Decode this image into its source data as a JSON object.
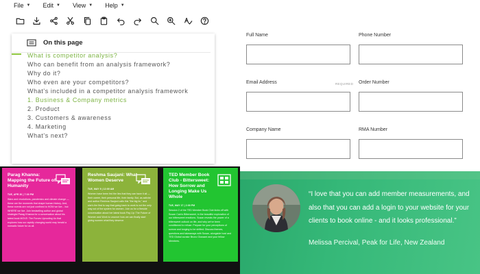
{
  "menubar": {
    "items": [
      {
        "label": "File"
      },
      {
        "label": "Edit"
      },
      {
        "label": "View"
      },
      {
        "label": "Help"
      }
    ]
  },
  "toolbar": {
    "icons": [
      "folder-open-icon",
      "download-icon",
      "share-icon",
      "cut-icon",
      "copy-icon",
      "paste-icon",
      "undo-icon",
      "redo-icon",
      "zoom-in-icon",
      "zoom-out-icon",
      "spell-check-icon",
      "help-icon"
    ]
  },
  "toc": {
    "title": "On this page",
    "items": [
      {
        "label": "What is competitor analysis?"
      },
      {
        "label": "Who can benefit from an analysis framework?"
      },
      {
        "label": "Why do it?"
      },
      {
        "label": "Who even are your competitors?"
      },
      {
        "label": "What's included in a competitor analysis framework"
      },
      {
        "label": "1. Business & Company metrics"
      },
      {
        "label": "2. Product"
      },
      {
        "label": "3. Customers & awareness"
      },
      {
        "label": "4. Marketing"
      },
      {
        "label": "What's next?"
      }
    ]
  },
  "form": {
    "full_name": "Full Name",
    "phone_number": "Phone Number",
    "email_address": "Email Address",
    "required": "REQUIRED",
    "order_number": "Order Number",
    "company_name": "Company Name",
    "rma_number": "RMA Number"
  },
  "cards": [
    {
      "title": "Parag Khanna: Mapping the Future of Humanity",
      "meta": "TUE, APR 20 | 7:00 PM",
      "body": "Wars and revolutions, pandemics and climate change — these are the moments that shape human history. And, these events are not just confined to HOW we live... but WHERE we live. Join bestselling author and global strategist Parag Khanna for a conversation about his latest book MOVE: The Forces Uprooting Us that explores how our rapidly changing world may herald a nomadic future for us all.",
      "color": "#e6289b"
    },
    {
      "title": "Reshma Saujani: What Women Deserve",
      "meta": "TUE, MAY 9 | 12:00 AM",
      "body": "Women have been fed the lies that they can have it all — their career, their personal life, their family. But, as activist and author Reshma Saujani calls this \"the big lie,\" and she's the first to say that going back to work is not the only way out of the system for women. Join us for a fireside conversation about her latest book Pay Up: The Future of Women and Work to uncover how we can finally start giving women what they deserve.",
      "color": "#8cb33b"
    },
    {
      "title": "TED Member Book Club - Bittersweet: How Sorrow and Longing Make Us Whole",
      "meta": "TUE, MAY 17 | 2:00 PM",
      "body": "Session 2 of the TED Member Book Club kicks off with Susan Cain's Bittersweet, in the beautiful exploration of our bittersweet emotions. Susan reveals the power of a bittersweet outlook on life, and why we've been conditioned to refuse. Prepare for your perceptions of sorrow and longing to be shifted. Discuss themes, questions and takeaways with Susan, alongside host and TED Global curator Bruno Giussani and your fellow Members.",
      "color": "#22c531"
    }
  ],
  "testimonial": {
    "quote": "“I love that you can add member measurements, and also that you can add a login to your website for your clients to book online - and it looks professional.”",
    "author": "Melissa Percival, Peak for Life, New Zealand"
  }
}
